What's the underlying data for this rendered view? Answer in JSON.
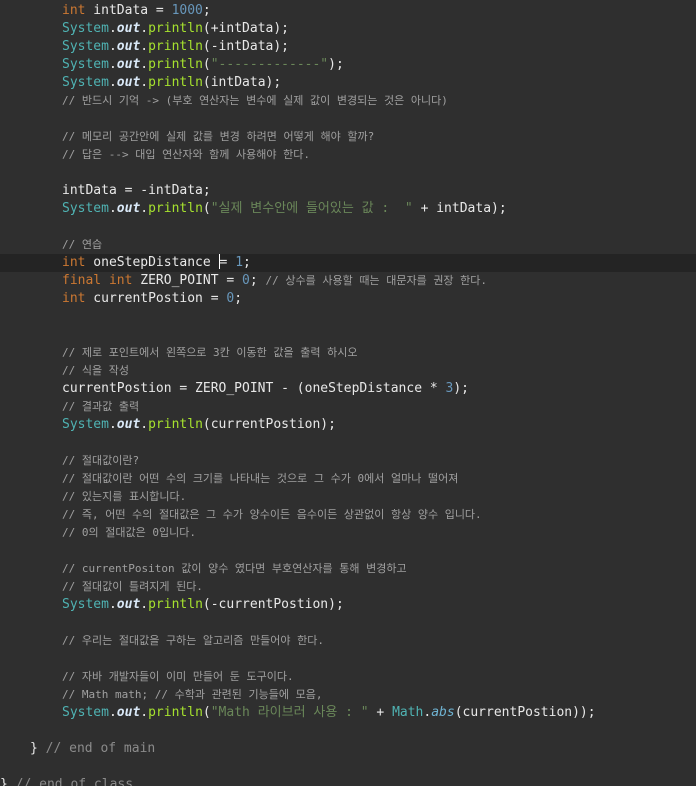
{
  "editor": {
    "lines": [
      [
        [
          "kw",
          "int"
        ],
        [
          "id",
          " intData = "
        ],
        [
          "num",
          "1000"
        ],
        [
          "id",
          ";"
        ]
      ],
      [
        [
          "cls",
          "System"
        ],
        [
          "id",
          "."
        ],
        [
          "fld",
          "out"
        ],
        [
          "id",
          "."
        ],
        [
          "mth",
          "println"
        ],
        [
          "id",
          "(+intData);"
        ]
      ],
      [
        [
          "cls",
          "System"
        ],
        [
          "id",
          "."
        ],
        [
          "fld",
          "out"
        ],
        [
          "id",
          "."
        ],
        [
          "mth",
          "println"
        ],
        [
          "id",
          "(-intData);"
        ]
      ],
      [
        [
          "cls",
          "System"
        ],
        [
          "id",
          "."
        ],
        [
          "fld",
          "out"
        ],
        [
          "id",
          "."
        ],
        [
          "mth",
          "println"
        ],
        [
          "id",
          "("
        ],
        [
          "str",
          "\"-------------\""
        ],
        [
          "id",
          ");"
        ]
      ],
      [
        [
          "cls",
          "System"
        ],
        [
          "id",
          "."
        ],
        [
          "fld",
          "out"
        ],
        [
          "id",
          "."
        ],
        [
          "mth",
          "println"
        ],
        [
          "id",
          "(intData);"
        ]
      ],
      [
        [
          "cmt",
          "// 반드시 기억 -> (부호 연산자는 변수에 실제 값이 변경되는 것은 아니다)"
        ]
      ],
      [],
      [
        [
          "cmt",
          "// 메모리 공간안에 실제 값를 변경 하려면 어떻게 해야 할까?"
        ]
      ],
      [
        [
          "cmt",
          "// 답은 --> 대입 연산자와 함께 사용해야 한다."
        ]
      ],
      [],
      [
        [
          "id",
          "intData = -intData;"
        ]
      ],
      [
        [
          "cls",
          "System"
        ],
        [
          "id",
          "."
        ],
        [
          "fld",
          "out"
        ],
        [
          "id",
          "."
        ],
        [
          "mth",
          "println"
        ],
        [
          "id",
          "("
        ],
        [
          "str",
          "\"실제 변수안에 들어있는 값 :  \""
        ],
        [
          "id",
          " + intData);"
        ]
      ],
      [],
      [
        [
          "cmt",
          "// 연습"
        ]
      ],
      [
        [
          "kw",
          "int"
        ],
        [
          "id",
          " oneStepDistance "
        ],
        [
          "caret",
          ""
        ],
        [
          "id",
          "= "
        ],
        [
          "num",
          "1"
        ],
        [
          "id",
          ";"
        ]
      ],
      [
        [
          "kw",
          "final"
        ],
        [
          "id",
          " "
        ],
        [
          "kw",
          "int"
        ],
        [
          "id",
          " ZERO_POINT = "
        ],
        [
          "num",
          "0"
        ],
        [
          "id",
          "; "
        ],
        [
          "cmt",
          "// 상수를 사용할 때는 대문자를 권장 한다."
        ]
      ],
      [
        [
          "kw",
          "int"
        ],
        [
          "id",
          " currentPostion = "
        ],
        [
          "num",
          "0"
        ],
        [
          "id",
          ";"
        ]
      ],
      [],
      [],
      [
        [
          "cmt",
          "// 제로 포인트에서 왼쪽으로 3칸 이동한 값을 출력 하시오"
        ]
      ],
      [
        [
          "cmt",
          "// 식을 작성"
        ]
      ],
      [
        [
          "id",
          "currentPostion = ZERO_POINT - (oneStepDistance * "
        ],
        [
          "num",
          "3"
        ],
        [
          "id",
          ");"
        ]
      ],
      [
        [
          "cmt",
          "// 결과값 출력"
        ]
      ],
      [
        [
          "cls",
          "System"
        ],
        [
          "id",
          "."
        ],
        [
          "fld",
          "out"
        ],
        [
          "id",
          "."
        ],
        [
          "mth",
          "println"
        ],
        [
          "id",
          "(currentPostion);"
        ]
      ],
      [],
      [
        [
          "cmt",
          "// 절대값이란?"
        ]
      ],
      [
        [
          "cmt",
          "// 절대값이란 어떤 수의 크기를 나타내는 것으로 그 수가 0에서 얼마나 떨어져"
        ]
      ],
      [
        [
          "cmt",
          "// 있는지를 표시합니다."
        ]
      ],
      [
        [
          "cmt",
          "// 즉, 어떤 수의 절대값은 그 수가 양수이든 음수이든 상관없이 항상 양수 입니다."
        ]
      ],
      [
        [
          "cmt",
          "// 0의 절대값은 0입니다."
        ]
      ],
      [],
      [
        [
          "cmt",
          "// currentPositon 값이 양수 였다면 부호연산자를 통해 변경하고"
        ]
      ],
      [
        [
          "cmt",
          "// 절대값이 틀려지게 된다."
        ]
      ],
      [
        [
          "cls",
          "System"
        ],
        [
          "id",
          "."
        ],
        [
          "fld",
          "out"
        ],
        [
          "id",
          "."
        ],
        [
          "mth",
          "println"
        ],
        [
          "id",
          "(-currentPostion);"
        ]
      ],
      [],
      [
        [
          "cmt",
          "// 우리는 절대값을 구하는 알고리즘 만들어야 한다."
        ]
      ],
      [],
      [
        [
          "cmt",
          "// 자바 개발자들이 이미 만들어 둔 도구이다."
        ]
      ],
      [
        [
          "cmt",
          "// Math math; // 수학과 관련된 기능들에 모음,"
        ]
      ],
      [
        [
          "cls",
          "System"
        ],
        [
          "id",
          "."
        ],
        [
          "fld",
          "out"
        ],
        [
          "id",
          "."
        ],
        [
          "mth",
          "println"
        ],
        [
          "id",
          "("
        ],
        [
          "str",
          "\"Math 라이브러 사용 : \""
        ],
        [
          "id",
          " + "
        ],
        [
          "cls",
          "Math"
        ],
        [
          "id",
          "."
        ],
        [
          "mi",
          "abs"
        ],
        [
          "id",
          "(currentPostion));"
        ]
      ],
      [],
      [
        [
          "id",
          "} "
        ],
        [
          "cmt",
          "// end of main"
        ]
      ],
      [],
      [
        [
          "id",
          "} "
        ],
        [
          "cmt",
          "// end of class"
        ]
      ]
    ],
    "indents": [
      62,
      62,
      62,
      62,
      62,
      62,
      62,
      62,
      62,
      62,
      62,
      62,
      62,
      62,
      62,
      62,
      62,
      62,
      62,
      62,
      62,
      62,
      62,
      62,
      62,
      62,
      62,
      62,
      62,
      62,
      62,
      62,
      62,
      62,
      62,
      62,
      62,
      62,
      62,
      62,
      62,
      30,
      30,
      0
    ],
    "current_line": 14
  }
}
